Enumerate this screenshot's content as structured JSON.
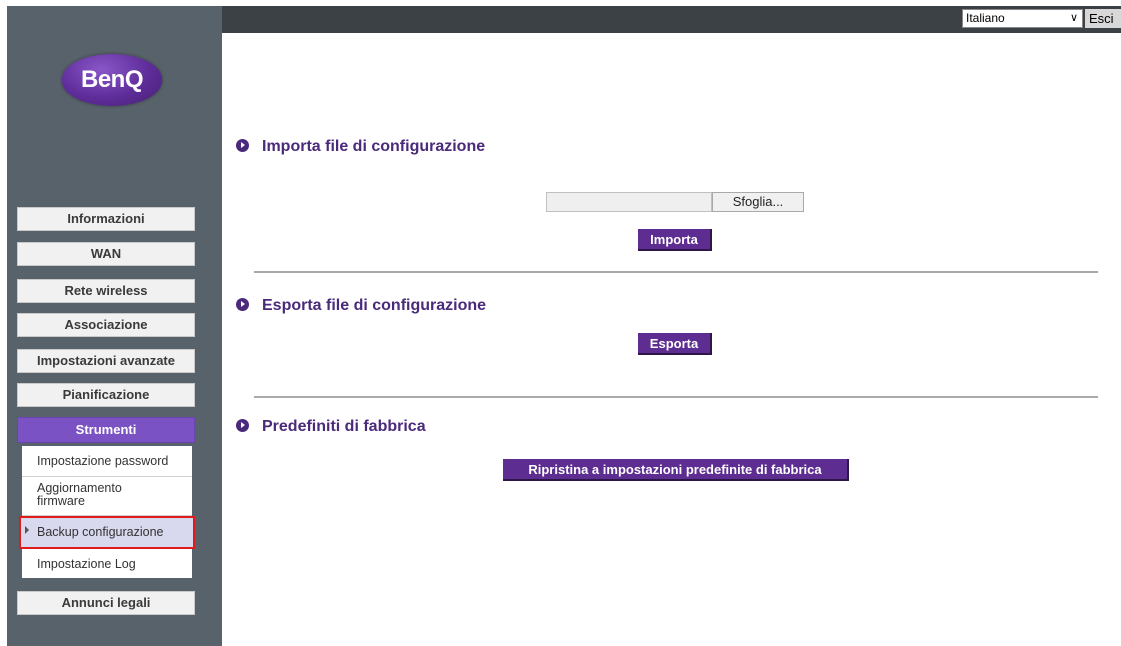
{
  "brand": {
    "logo_text": "BenQ",
    "accent": "#5d2d91",
    "sidebar_bg": "#58626a"
  },
  "topbar": {
    "language_selected": "Italiano",
    "logout_label": "Esci"
  },
  "sidebar": {
    "items": [
      {
        "label": "Informazioni"
      },
      {
        "label": "WAN"
      },
      {
        "label": "Rete wireless"
      },
      {
        "label": "Associazione"
      },
      {
        "label": "Impostazioni avanzate"
      },
      {
        "label": "Pianificazione"
      },
      {
        "label": "Strumenti",
        "active": true
      },
      {
        "label": "Annunci legali"
      }
    ],
    "submenu": [
      {
        "label": "Impostazione password"
      },
      {
        "label": "Aggiornamento firmware"
      },
      {
        "label": "Backup configurazione",
        "selected": true
      },
      {
        "label": "Impostazione Log"
      }
    ]
  },
  "main": {
    "import": {
      "title": "Importa file di configurazione",
      "browse_label": "Sfoglia...",
      "file_value": "",
      "button_label": "Importa"
    },
    "export": {
      "title": "Esporta file di configurazione",
      "button_label": "Esporta"
    },
    "factory": {
      "title": "Predefiniti di fabbrica",
      "button_label": "Ripristina a impostazioni predefinite di fabbrica"
    }
  }
}
